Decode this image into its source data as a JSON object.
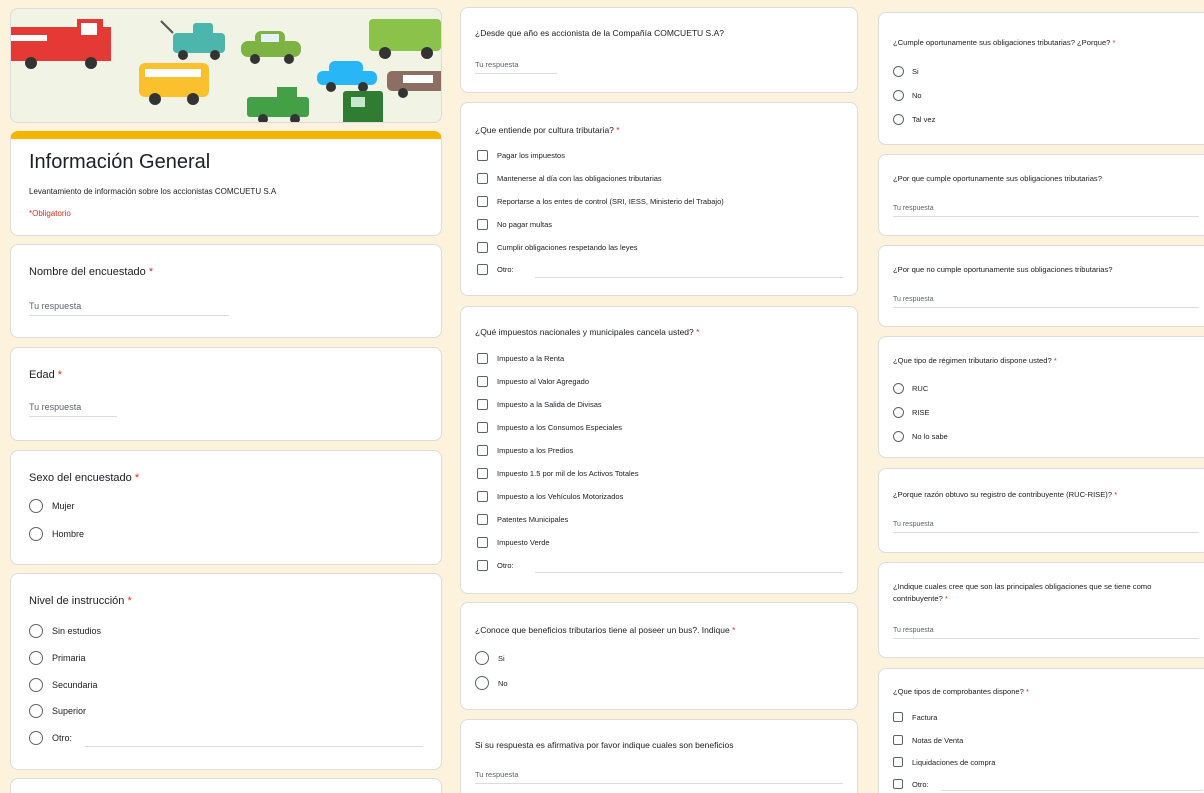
{
  "form": {
    "title": "Información General",
    "description": "Levantamiento de información sobre los accionistas COMCUETU S.A",
    "required_note": "*Obligatorio",
    "answer_placeholder": "Tu respuesta",
    "required_mark": "*"
  },
  "column1": {
    "q_nombre": "Nombre del encuestado",
    "q_edad": "Edad",
    "q_sexo": "Sexo del encuestado",
    "sexo_options": [
      "Mujer",
      "Hombre"
    ],
    "q_nivel": "Nivel de instrucción",
    "nivel_options": [
      "Sin estudios",
      "Primaria",
      "Secundaria",
      "Superior",
      "Otro:"
    ]
  },
  "column2": {
    "q_anio": "¿Desde que año es accionista de la Compañía COMCUETU S.A?",
    "q_cultura": "¿Que entiende por cultura tributaria?",
    "cultura_options": [
      "Pagar los impuestos",
      "Mantenerse al día con las obligaciones tributarias",
      "Reportarse a los entes de control (SRI, IESS, Ministerio del Trabajo)",
      "No pagar multas",
      "Cumplir obligaciones respetando las leyes",
      "Otro:"
    ],
    "q_impuestos": "¿Qué impuestos nacionales y municipales cancela usted?",
    "impuestos_options": [
      "Impuesto a la Renta",
      "Impuesto al Valor Agregado",
      "Impuesto a la Salida de Divisas",
      "Impuesto a los Consumos Especiales",
      "Impuesto a los Predios",
      "Impuesto 1.5 por mil de los Activos Totales",
      "Impuesto a los Vehículos Motorizados",
      "Patentes Municipales",
      "Impuesto Verde",
      "Otro:"
    ],
    "q_beneficios": "¿Conoce que beneficios tributarios tiene al poseer un bus?. Indique",
    "beneficios_options": [
      "Si",
      "No"
    ],
    "q_afirmativa": "Si su respuesta es afirmativa por favor indique cuales son beneficios"
  },
  "column3": {
    "q_cumple": "¿Cumple oportunamente sus obligaciones tributarias? ¿Porque?",
    "cumple_options": [
      "Si",
      "No",
      "Tal vez"
    ],
    "q_porque_cumple": "¿Por que cumple oportunamente sus obligaciones tributarias?",
    "q_porque_no": "¿Por que no cumple oportunamente sus obligaciones tributarias?",
    "q_regimen": "¿Que tipo de régimen tributario dispone usted?",
    "regimen_options": [
      "RUC",
      "RISE",
      "No lo sabe"
    ],
    "q_razon": "¿Porque razón obtuvo su registro de contribuyente (RUC-RISE)?",
    "q_obligaciones": "¿Indique cuales cree que son las principales obligaciones que se tiene como contribuyente?",
    "q_comprobantes": "¿Que tipos de comprobantes dispone?",
    "comprobantes_options": [
      "Factura",
      "Notas de Venta",
      "Liquidaciones de compra",
      "Otro:"
    ]
  },
  "colors": {
    "accent": "#f4b400",
    "required": "#d93025",
    "background": "#fdf3dc"
  }
}
